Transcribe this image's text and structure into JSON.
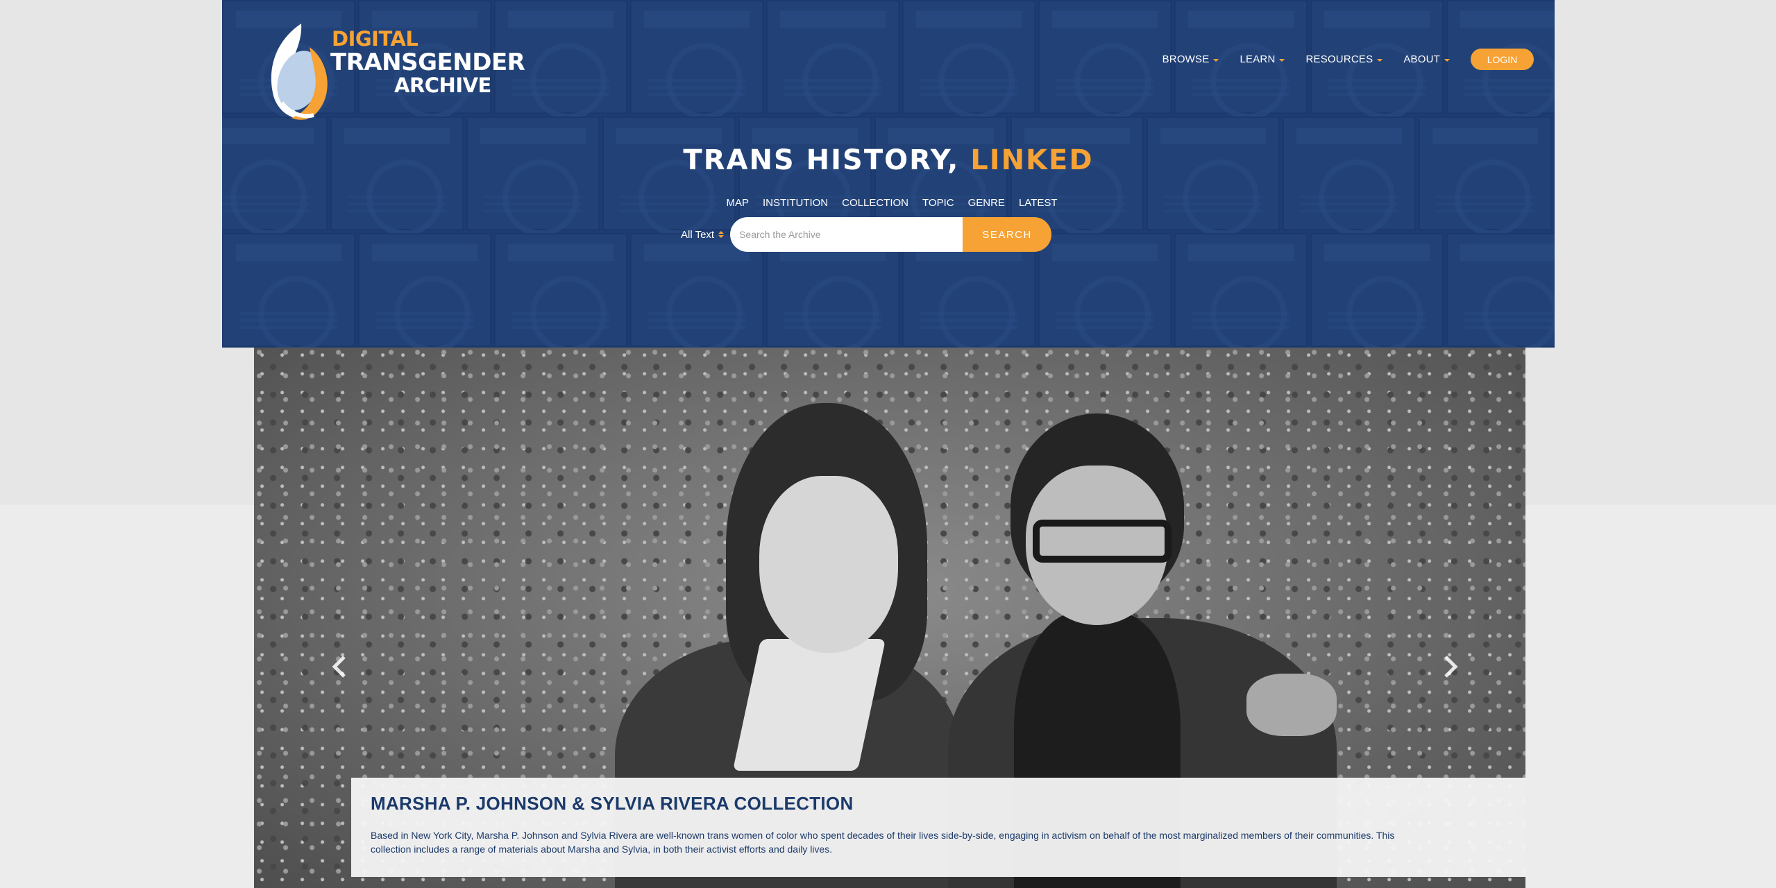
{
  "logo": {
    "line1": "DIGITAL",
    "line2": "TRANSGENDER",
    "line3": "ARCHIVE"
  },
  "nav": {
    "items": [
      {
        "label": "BROWSE",
        "icon": "caret-down-icon"
      },
      {
        "label": "LEARN",
        "icon": "caret-down-icon"
      },
      {
        "label": "RESOURCES",
        "icon": "caret-down-icon"
      },
      {
        "label": "ABOUT",
        "icon": "caret-down-icon"
      }
    ],
    "login_label": "LOGIN"
  },
  "hero": {
    "tagline_part1": "TRANS HISTORY, ",
    "tagline_part2": "LINKED"
  },
  "browse_links": [
    "MAP",
    "INSTITUTION",
    "COLLECTION",
    "TOPIC",
    "GENRE",
    "LATEST"
  ],
  "search": {
    "type_selected": "All Text",
    "placeholder": "Search the Archive",
    "button_label": "SEARCH"
  },
  "carousel": {
    "caption_title": "MARSHA P. JOHNSON & SYLVIA RIVERA COLLECTION",
    "caption_text": "Based in New York City, Marsha P. Johnson and Sylvia Rivera are well-known trans women of color who spent decades of their lives side-by-side, engaging in activism on behalf of the most marginalized members of their communities. This collection includes a range of materials about Marsha and Sylvia, in both their activist efforts and daily lives."
  },
  "colors": {
    "brand_blue": "#1f3f75",
    "accent_orange": "#f6a234",
    "caption_text": "#1b3a6b"
  }
}
